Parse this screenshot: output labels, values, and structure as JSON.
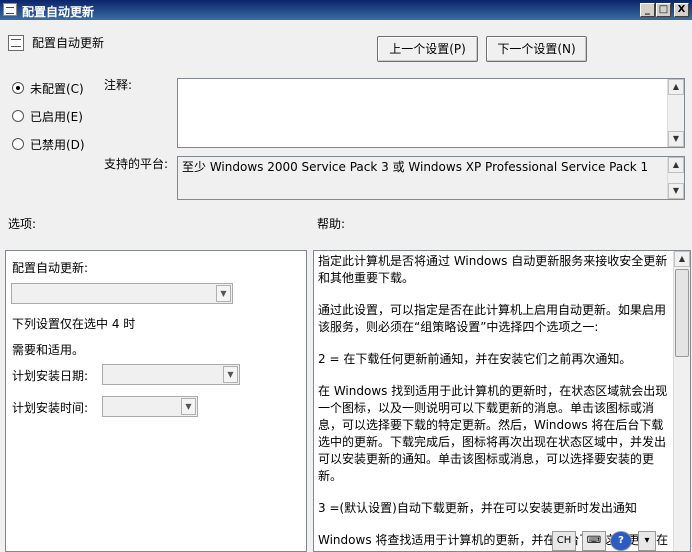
{
  "window": {
    "title": "配置自动更新",
    "minimize_glyph": "_",
    "maximize_glyph": "□",
    "close_glyph": "X"
  },
  "header": {
    "policy_name": "配置自动更新",
    "prev_button": "上一个设置(P)",
    "next_button": "下一个设置(N)"
  },
  "state_options": [
    {
      "label": "未配置(C)",
      "checked": true
    },
    {
      "label": "已启用(E)",
      "checked": false
    },
    {
      "label": "已禁用(D)",
      "checked": false
    }
  ],
  "comment": {
    "label": "注释:",
    "value": ""
  },
  "platform": {
    "label": "支持的平台:",
    "value": "至少 Windows 2000 Service Pack 3 或 Windows XP Professional Service Pack 1"
  },
  "options": {
    "section_label": "选项:",
    "configure_label": "配置自动更新:",
    "configure_value": "",
    "note_line1": "下列设置仅在选中 4 时",
    "note_line2": "需要和适用。",
    "schedule_day_label": "计划安装日期:",
    "schedule_day_value": "",
    "schedule_time_label": "计划安装时间:",
    "schedule_time_value": ""
  },
  "help": {
    "section_label": "帮助:",
    "paragraphs": [
      "指定此计算机是否将通过 Windows 自动更新服务来接收安全更新和其他重要下载。",
      "通过此设置，可以指定是否在此计算机上启用自动更新。如果启用该服务，则必须在“组策略设置”中选择四个选项之一:",
      "2 = 在下载任何更新前通知，并在安装它们之前再次通知。",
      "在 Windows 找到适用于此计算机的更新时，在状态区域就会出现一个图标，以及一则说明可以下载更新的消息。单击该图标或消息，可以选择要下载的特定更新。然后，Windows 将在后台下载选中的更新。下载完成后，图标将再次出现在状态区域中，并发出可以安装更新的通知。单击该图标或消息，可以选择要安装的更新。",
      "3 =(默认设置)自动下载更新，并在可以安装更新时发出通知",
      "Windows 将查找适用于计算机的更新，并在后台下载这些更新(在"
    ]
  },
  "tray": {
    "ime_label": "CH",
    "help_glyph": "?"
  }
}
